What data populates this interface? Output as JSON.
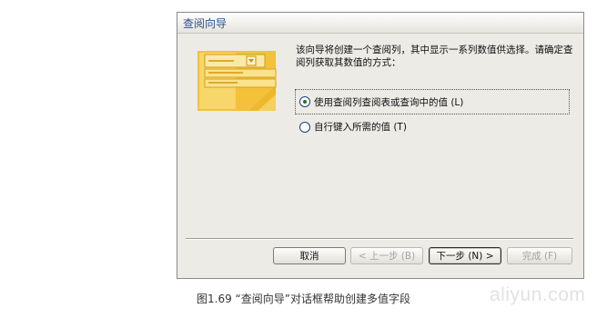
{
  "dialog": {
    "title": "查阅向导",
    "description": "该向导将创建一个查阅列，其中显示一系列数值供选择。请确定查阅列获取其数值的方式：",
    "options": [
      {
        "label": "使用查阅列查阅表或查询中的值 (L)",
        "selected": true
      },
      {
        "label": "自行键入所需的值 (T)",
        "selected": false
      }
    ],
    "buttons": {
      "cancel": "取消",
      "back": "< 上一步 (B)",
      "next": "下一步 (N) >",
      "finish": "完成 (F)"
    }
  },
  "caption": "图1.69 “查阅向导”对话框帮助创建多值字段",
  "watermark": "aliyun.com",
  "colors": {
    "title_text": "#2e4f8c",
    "art_yellow": "#f6c93a",
    "dialog_bg": "#ecebe6"
  }
}
